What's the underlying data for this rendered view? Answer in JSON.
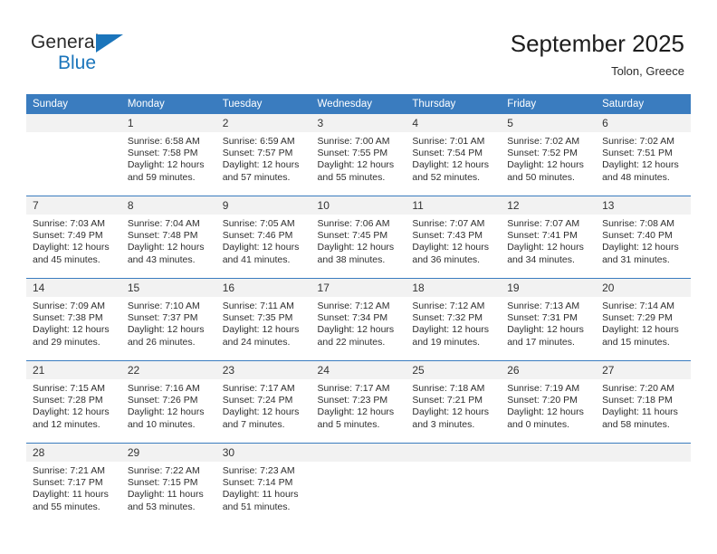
{
  "brand": {
    "name_part1": "General",
    "name_part2": "Blue",
    "accent_color": "#1b75bb"
  },
  "header": {
    "title": "September 2025",
    "subtitle": "Tolon, Greece"
  },
  "calendar": {
    "header_bg": "#3a7cbf",
    "daynum_bg": "#f2f2f2",
    "weekday_headers": [
      "Sunday",
      "Monday",
      "Tuesday",
      "Wednesday",
      "Thursday",
      "Friday",
      "Saturday"
    ],
    "weeks": [
      [
        {
          "day": "",
          "sunrise": "",
          "sunset": "",
          "daylight_1": "",
          "daylight_2": ""
        },
        {
          "day": "1",
          "sunrise": "Sunrise: 6:58 AM",
          "sunset": "Sunset: 7:58 PM",
          "daylight_1": "Daylight: 12 hours",
          "daylight_2": "and 59 minutes."
        },
        {
          "day": "2",
          "sunrise": "Sunrise: 6:59 AM",
          "sunset": "Sunset: 7:57 PM",
          "daylight_1": "Daylight: 12 hours",
          "daylight_2": "and 57 minutes."
        },
        {
          "day": "3",
          "sunrise": "Sunrise: 7:00 AM",
          "sunset": "Sunset: 7:55 PM",
          "daylight_1": "Daylight: 12 hours",
          "daylight_2": "and 55 minutes."
        },
        {
          "day": "4",
          "sunrise": "Sunrise: 7:01 AM",
          "sunset": "Sunset: 7:54 PM",
          "daylight_1": "Daylight: 12 hours",
          "daylight_2": "and 52 minutes."
        },
        {
          "day": "5",
          "sunrise": "Sunrise: 7:02 AM",
          "sunset": "Sunset: 7:52 PM",
          "daylight_1": "Daylight: 12 hours",
          "daylight_2": "and 50 minutes."
        },
        {
          "day": "6",
          "sunrise": "Sunrise: 7:02 AM",
          "sunset": "Sunset: 7:51 PM",
          "daylight_1": "Daylight: 12 hours",
          "daylight_2": "and 48 minutes."
        }
      ],
      [
        {
          "day": "7",
          "sunrise": "Sunrise: 7:03 AM",
          "sunset": "Sunset: 7:49 PM",
          "daylight_1": "Daylight: 12 hours",
          "daylight_2": "and 45 minutes."
        },
        {
          "day": "8",
          "sunrise": "Sunrise: 7:04 AM",
          "sunset": "Sunset: 7:48 PM",
          "daylight_1": "Daylight: 12 hours",
          "daylight_2": "and 43 minutes."
        },
        {
          "day": "9",
          "sunrise": "Sunrise: 7:05 AM",
          "sunset": "Sunset: 7:46 PM",
          "daylight_1": "Daylight: 12 hours",
          "daylight_2": "and 41 minutes."
        },
        {
          "day": "10",
          "sunrise": "Sunrise: 7:06 AM",
          "sunset": "Sunset: 7:45 PM",
          "daylight_1": "Daylight: 12 hours",
          "daylight_2": "and 38 minutes."
        },
        {
          "day": "11",
          "sunrise": "Sunrise: 7:07 AM",
          "sunset": "Sunset: 7:43 PM",
          "daylight_1": "Daylight: 12 hours",
          "daylight_2": "and 36 minutes."
        },
        {
          "day": "12",
          "sunrise": "Sunrise: 7:07 AM",
          "sunset": "Sunset: 7:41 PM",
          "daylight_1": "Daylight: 12 hours",
          "daylight_2": "and 34 minutes."
        },
        {
          "day": "13",
          "sunrise": "Sunrise: 7:08 AM",
          "sunset": "Sunset: 7:40 PM",
          "daylight_1": "Daylight: 12 hours",
          "daylight_2": "and 31 minutes."
        }
      ],
      [
        {
          "day": "14",
          "sunrise": "Sunrise: 7:09 AM",
          "sunset": "Sunset: 7:38 PM",
          "daylight_1": "Daylight: 12 hours",
          "daylight_2": "and 29 minutes."
        },
        {
          "day": "15",
          "sunrise": "Sunrise: 7:10 AM",
          "sunset": "Sunset: 7:37 PM",
          "daylight_1": "Daylight: 12 hours",
          "daylight_2": "and 26 minutes."
        },
        {
          "day": "16",
          "sunrise": "Sunrise: 7:11 AM",
          "sunset": "Sunset: 7:35 PM",
          "daylight_1": "Daylight: 12 hours",
          "daylight_2": "and 24 minutes."
        },
        {
          "day": "17",
          "sunrise": "Sunrise: 7:12 AM",
          "sunset": "Sunset: 7:34 PM",
          "daylight_1": "Daylight: 12 hours",
          "daylight_2": "and 22 minutes."
        },
        {
          "day": "18",
          "sunrise": "Sunrise: 7:12 AM",
          "sunset": "Sunset: 7:32 PM",
          "daylight_1": "Daylight: 12 hours",
          "daylight_2": "and 19 minutes."
        },
        {
          "day": "19",
          "sunrise": "Sunrise: 7:13 AM",
          "sunset": "Sunset: 7:31 PM",
          "daylight_1": "Daylight: 12 hours",
          "daylight_2": "and 17 minutes."
        },
        {
          "day": "20",
          "sunrise": "Sunrise: 7:14 AM",
          "sunset": "Sunset: 7:29 PM",
          "daylight_1": "Daylight: 12 hours",
          "daylight_2": "and 15 minutes."
        }
      ],
      [
        {
          "day": "21",
          "sunrise": "Sunrise: 7:15 AM",
          "sunset": "Sunset: 7:28 PM",
          "daylight_1": "Daylight: 12 hours",
          "daylight_2": "and 12 minutes."
        },
        {
          "day": "22",
          "sunrise": "Sunrise: 7:16 AM",
          "sunset": "Sunset: 7:26 PM",
          "daylight_1": "Daylight: 12 hours",
          "daylight_2": "and 10 minutes."
        },
        {
          "day": "23",
          "sunrise": "Sunrise: 7:17 AM",
          "sunset": "Sunset: 7:24 PM",
          "daylight_1": "Daylight: 12 hours",
          "daylight_2": "and 7 minutes."
        },
        {
          "day": "24",
          "sunrise": "Sunrise: 7:17 AM",
          "sunset": "Sunset: 7:23 PM",
          "daylight_1": "Daylight: 12 hours",
          "daylight_2": "and 5 minutes."
        },
        {
          "day": "25",
          "sunrise": "Sunrise: 7:18 AM",
          "sunset": "Sunset: 7:21 PM",
          "daylight_1": "Daylight: 12 hours",
          "daylight_2": "and 3 minutes."
        },
        {
          "day": "26",
          "sunrise": "Sunrise: 7:19 AM",
          "sunset": "Sunset: 7:20 PM",
          "daylight_1": "Daylight: 12 hours",
          "daylight_2": "and 0 minutes."
        },
        {
          "day": "27",
          "sunrise": "Sunrise: 7:20 AM",
          "sunset": "Sunset: 7:18 PM",
          "daylight_1": "Daylight: 11 hours",
          "daylight_2": "and 58 minutes."
        }
      ],
      [
        {
          "day": "28",
          "sunrise": "Sunrise: 7:21 AM",
          "sunset": "Sunset: 7:17 PM",
          "daylight_1": "Daylight: 11 hours",
          "daylight_2": "and 55 minutes."
        },
        {
          "day": "29",
          "sunrise": "Sunrise: 7:22 AM",
          "sunset": "Sunset: 7:15 PM",
          "daylight_1": "Daylight: 11 hours",
          "daylight_2": "and 53 minutes."
        },
        {
          "day": "30",
          "sunrise": "Sunrise: 7:23 AM",
          "sunset": "Sunset: 7:14 PM",
          "daylight_1": "Daylight: 11 hours",
          "daylight_2": "and 51 minutes."
        },
        {
          "day": "",
          "sunrise": "",
          "sunset": "",
          "daylight_1": "",
          "daylight_2": ""
        },
        {
          "day": "",
          "sunrise": "",
          "sunset": "",
          "daylight_1": "",
          "daylight_2": ""
        },
        {
          "day": "",
          "sunrise": "",
          "sunset": "",
          "daylight_1": "",
          "daylight_2": ""
        },
        {
          "day": "",
          "sunrise": "",
          "sunset": "",
          "daylight_1": "",
          "daylight_2": ""
        }
      ]
    ]
  }
}
